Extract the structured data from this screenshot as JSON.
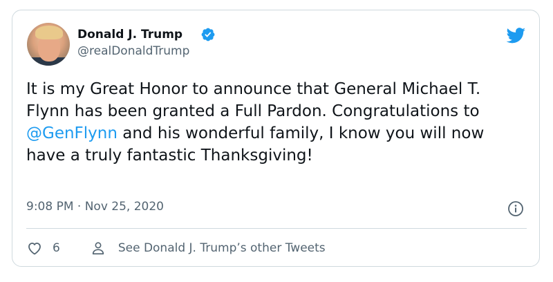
{
  "author": {
    "name": "Donald J. Trump",
    "handle": "@realDonaldTrump",
    "verified": true
  },
  "tweet": {
    "text_before_mention": "It is my Great Honor to announce that General Michael T. Flynn has been granted a Full Pardon. Congratulations to ",
    "mention": "@GenFlynn",
    "text_after_mention": " and his wonderful family, I know you will now have a truly fantastic Thanksgiving!",
    "timestamp": "9:08 PM · Nov 25, 2020"
  },
  "actions": {
    "like_count": "6",
    "other_tweets_label": "See Donald J. Trump’s other Tweets"
  },
  "icons": {
    "brand": "twitter-bird-icon",
    "verified": "verified-badge-icon",
    "info": "info-icon",
    "like": "heart-icon",
    "profile": "person-icon"
  },
  "colors": {
    "accent": "#1d9bf0",
    "text": "#0f1419",
    "secondary_text": "#536471",
    "border": "#cfd9de"
  }
}
